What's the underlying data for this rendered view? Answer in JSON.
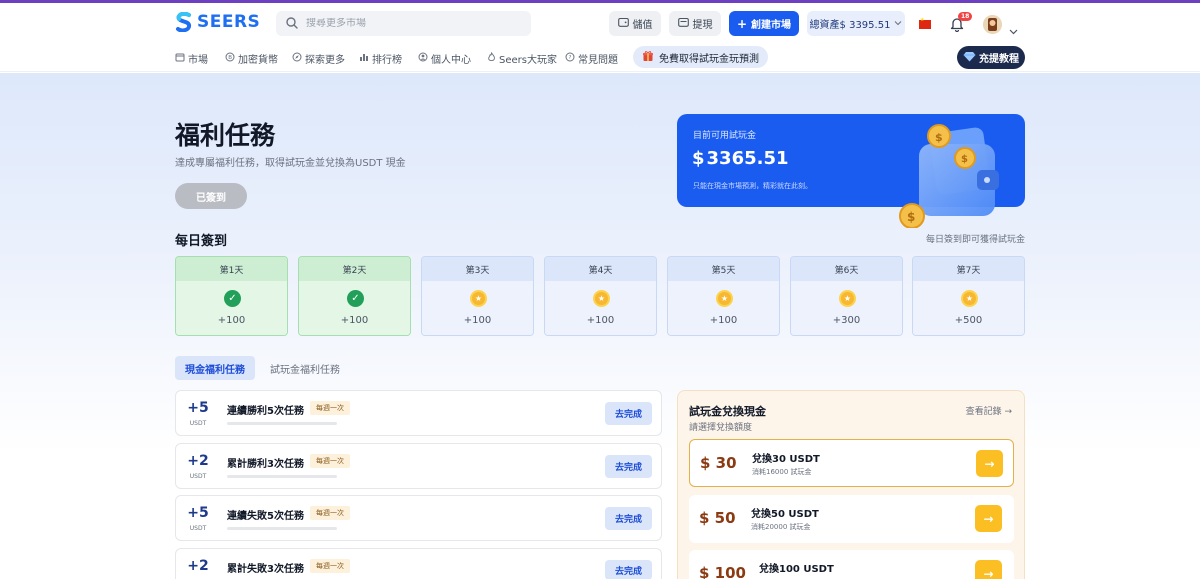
{
  "brand": {
    "name": "SEERS",
    "accent": "#1a5cf0"
  },
  "header": {
    "search_placeholder": "搜尋更多市場",
    "deposit_label": "儲值",
    "withdraw_label": "提現",
    "create_market_label": "創建市場",
    "total_assets_label": "總資產$ 3395.51",
    "notification_count": "18",
    "language_flag": "flag-cn-icon"
  },
  "nav": {
    "items": [
      {
        "label": "市場",
        "icon": "market-icon"
      },
      {
        "label": "加密貨幣",
        "icon": "coin-icon"
      },
      {
        "label": "探索更多",
        "icon": "compass-icon"
      },
      {
        "label": "排行榜",
        "icon": "chart-icon"
      },
      {
        "label": "個人中心",
        "icon": "user-icon"
      },
      {
        "label": "Seers大玩家",
        "icon": "flame-icon"
      },
      {
        "label": "常見問題",
        "icon": "question-icon"
      }
    ],
    "promo_label": "免費取得試玩金玩預測",
    "tutorial_label": "充提教程"
  },
  "page": {
    "title": "福利任務",
    "subtitle": "達成專屬福利任務，取得試玩金並兌換為USDT 現金",
    "signed_label": "已簽到"
  },
  "balance": {
    "label": "目前可用試玩金",
    "currency": "$",
    "amount": "3365.51",
    "note": "只能在現金市場預測，精彩就在此刻。"
  },
  "daily": {
    "title": "每日簽到",
    "hint": "每日簽到即可獲得試玩金",
    "days": [
      {
        "label": "第1天",
        "reward": "+100",
        "done": true
      },
      {
        "label": "第2天",
        "reward": "+100",
        "done": true
      },
      {
        "label": "第3天",
        "reward": "+100",
        "done": false
      },
      {
        "label": "第4天",
        "reward": "+100",
        "done": false
      },
      {
        "label": "第5天",
        "reward": "+100",
        "done": false
      },
      {
        "label": "第6天",
        "reward": "+300",
        "done": false
      },
      {
        "label": "第7天",
        "reward": "+500",
        "done": false
      }
    ]
  },
  "tabs": {
    "cash": "現金福利任務",
    "trial": "試玩金福利任務"
  },
  "tasks": [
    {
      "amount": "+5",
      "unit": "USDT",
      "name": "連續勝利5次任務",
      "tag": "每週一次",
      "action": "去完成"
    },
    {
      "amount": "+2",
      "unit": "USDT",
      "name": "累計勝利3次任務",
      "tag": "每週一次",
      "action": "去完成"
    },
    {
      "amount": "+5",
      "unit": "USDT",
      "name": "連續失敗5次任務",
      "tag": "每週一次",
      "action": "去完成"
    },
    {
      "amount": "+2",
      "unit": "USDT",
      "name": "累計失敗3次任務",
      "tag": "每週一次",
      "action": "去完成"
    }
  ],
  "exchange": {
    "title": "試玩金兌換現金",
    "subtitle": "請選擇兌換額度",
    "link": "查看記錄 →",
    "items": [
      {
        "price": "$ 30",
        "name": "兌換30 USDT",
        "cost": "消耗16000 試玩金",
        "selected": true
      },
      {
        "price": "$ 50",
        "name": "兌換50 USDT",
        "cost": "消耗20000 試玩金",
        "selected": false
      },
      {
        "price": "$ 100",
        "name": "兌換100 USDT",
        "cost": "",
        "selected": false
      }
    ],
    "arrow": "→"
  }
}
